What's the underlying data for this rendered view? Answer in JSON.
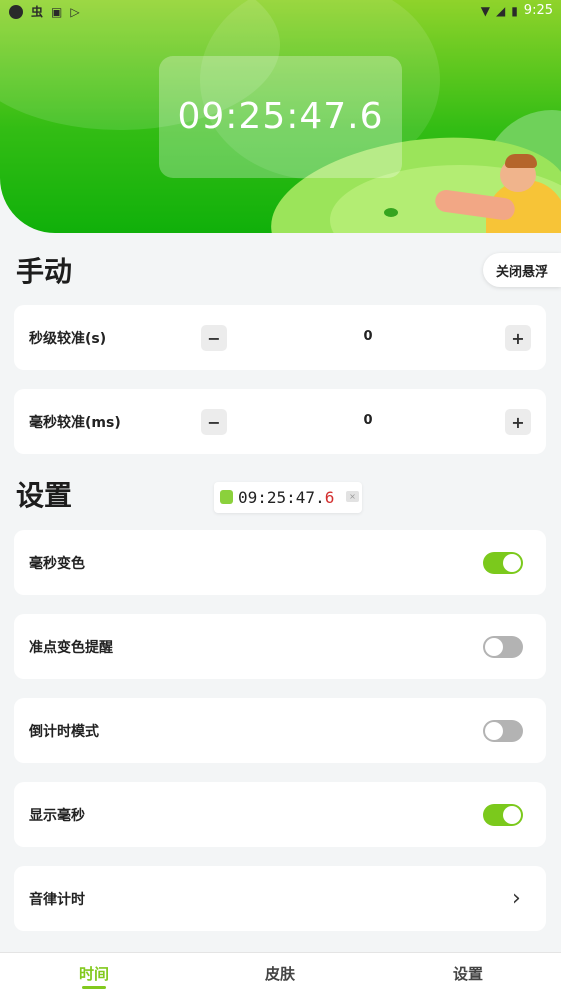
{
  "status_bar": {
    "time": "9:25",
    "icons": [
      "record-dot-icon",
      "bug-icon",
      "a-badge-icon",
      "play-store-icon",
      "wifi-icon",
      "no-signal-icon",
      "battery-icon"
    ]
  },
  "header": {
    "clock_display": "09:25:47.6"
  },
  "manual_section": {
    "title": "手动",
    "float_toggle_label": "关闭悬浮",
    "rows": [
      {
        "label": "秒级较准(s)",
        "value": "0",
        "minus": "−",
        "plus": "+"
      },
      {
        "label": "毫秒较准(ms)",
        "value": "0",
        "minus": "−",
        "plus": "+"
      }
    ]
  },
  "settings_section": {
    "title": "设置",
    "rows": [
      {
        "label": "毫秒变色",
        "state": "on"
      },
      {
        "label": "准点变色提醒",
        "state": "off"
      },
      {
        "label": "倒计时模式",
        "state": "off"
      },
      {
        "label": "显示毫秒",
        "state": "on"
      },
      {
        "label": "音律计时",
        "chevron": "›"
      }
    ]
  },
  "floating_widget": {
    "time_main": "09:25:47.",
    "time_ms": "6",
    "close": "×"
  },
  "tab_bar": {
    "tabs": [
      {
        "label": "时间",
        "active": true
      },
      {
        "label": "皮肤",
        "active": false
      },
      {
        "label": "设置",
        "active": false
      }
    ]
  },
  "colors": {
    "accent": "#82c91e",
    "toggle_on": "#7bc91c",
    "toggle_off": "#b3b3b3",
    "milliseconds_highlight": "#d32f2f"
  }
}
